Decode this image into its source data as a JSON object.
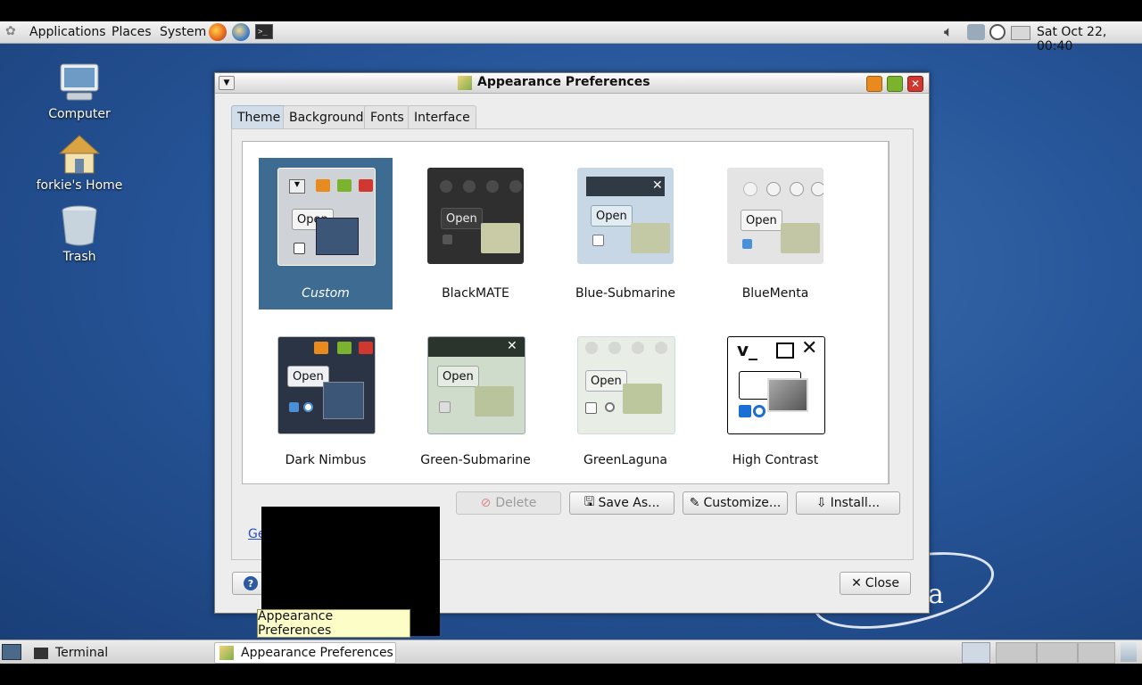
{
  "top_panel": {
    "menus": [
      "Applications",
      "Places",
      "System"
    ],
    "clock": "Sat Oct 22, 00:40"
  },
  "desktop_icons": [
    {
      "label": "Computer",
      "icon": "computer-icon"
    },
    {
      "label": "forkie's Home",
      "icon": "home-folder-icon"
    },
    {
      "label": "Trash",
      "icon": "trash-icon"
    }
  ],
  "window": {
    "title": "Appearance Preferences",
    "tabs": [
      "Theme",
      "Background",
      "Fonts",
      "Interface"
    ],
    "selected_tab": "Theme",
    "themes": [
      {
        "name": "Custom",
        "selected": true
      },
      {
        "name": "BlackMATE"
      },
      {
        "name": "Blue-Submarine"
      },
      {
        "name": "BlueMenta"
      },
      {
        "name": "Dark Nimbus"
      },
      {
        "name": "Green-Submarine"
      },
      {
        "name": "GreenLaguna"
      },
      {
        "name": "High Contrast"
      }
    ],
    "thumb_open_label": "Open",
    "buttons": {
      "delete": "Delete",
      "save_as": "Save As...",
      "customize": "Customize...",
      "install": "Install...",
      "close": "Close"
    },
    "link_partial": "Ge"
  },
  "tooltip": "Appearance Preferences",
  "bottom_panel": {
    "tasks": [
      {
        "label": "Terminal",
        "active": false
      },
      {
        "label": "Appearance Preferences",
        "active": true
      }
    ]
  },
  "colors": {
    "desktop": "#27569a",
    "selection": "#3d6b91",
    "close_red": "#d0382f",
    "minimize_orange": "#e88a1d",
    "maximize_green": "#7bb32e"
  }
}
